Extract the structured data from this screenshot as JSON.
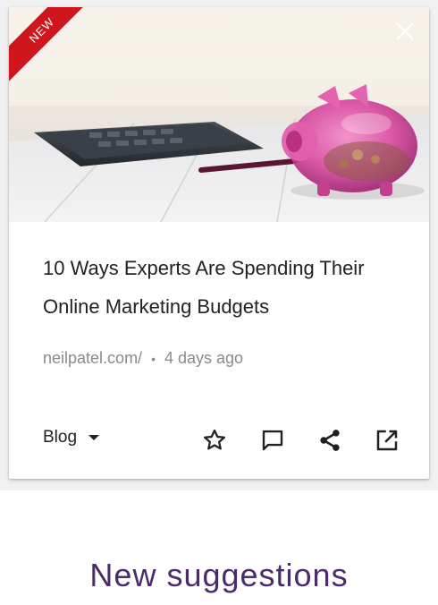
{
  "card": {
    "badge": "NEW",
    "title": "10 Ways Experts Are Spending Their Online Marketing Budgets",
    "source": "neilpatel.com/",
    "separator": "•",
    "age": "4 days ago",
    "category": "Blog",
    "icons": {
      "dismiss": "close-icon",
      "category_dropdown": "chevron-down-icon",
      "star": "star-outline-icon",
      "comment": "comment-icon",
      "share": "share-icon",
      "open": "open-in-new-icon"
    },
    "colors": {
      "badge": "#d0161d",
      "text": "#212121",
      "muted": "#8a8a8a"
    }
  },
  "section": {
    "heading": "New suggestions",
    "color": "#4a2c6a"
  }
}
